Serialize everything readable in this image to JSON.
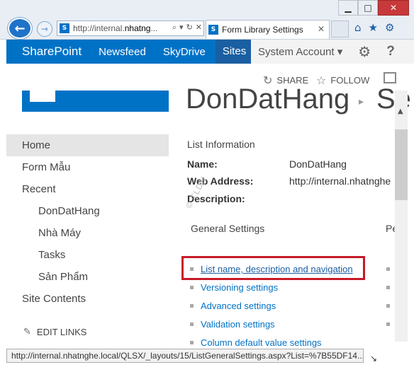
{
  "browser": {
    "address_prefix": "http://internal.",
    "address_host": "nhatng",
    "address_suffix": "...",
    "address_icons": [
      "search-icon",
      "refresh-icon",
      "stop-icon"
    ],
    "tab_title": "Form Library Settings",
    "favicon_letter": "S",
    "window_buttons": [
      "minimize",
      "maximize",
      "close"
    ]
  },
  "suitebar": {
    "brand": "SharePoint",
    "links": [
      "Newsfeed",
      "SkyDrive",
      "Sites"
    ],
    "active_link": "Sites",
    "account": "System Account ▾"
  },
  "actions": {
    "share": "SHARE",
    "follow": "FOLLOW"
  },
  "page": {
    "title": "DonDatHang",
    "title_next": "Se"
  },
  "nav": {
    "items": [
      {
        "label": "Home",
        "level": 0,
        "selected": true
      },
      {
        "label": "Form Mẫu",
        "level": 0
      },
      {
        "label": "Recent",
        "level": 0
      },
      {
        "label": "DonDatHang",
        "level": 1
      },
      {
        "label": "Nhà Máy",
        "level": 1
      },
      {
        "label": "Tasks",
        "level": 1
      },
      {
        "label": "Sản Phẩm",
        "level": 1
      },
      {
        "label": "Site Contents",
        "level": 0
      }
    ],
    "edit_links": "EDIT LINKS"
  },
  "list_info": {
    "heading": "List Information",
    "name_label": "Name:",
    "name_value": "DonDatHang",
    "web_address_label": "Web Address:",
    "web_address_value": "http://internal.nhatnghe",
    "description_label": "Description:"
  },
  "watermark": "© TLDN",
  "general_settings": {
    "heading": "General Settings",
    "heading_right": "Pe",
    "links": [
      "List name, description and navigation",
      "Versioning settings",
      "Advanced settings",
      "Validation settings",
      "Column default value settings"
    ]
  },
  "status_bar": {
    "url": "http://internal.nhatnghe.local/QLSX/_layouts/15/ListGeneralSettings.aspx?List=%7B55DF14..."
  },
  "colors": {
    "suite_blue": "#0072c6",
    "highlight_red": "#c61a28",
    "link_blue": "#0072c6"
  }
}
